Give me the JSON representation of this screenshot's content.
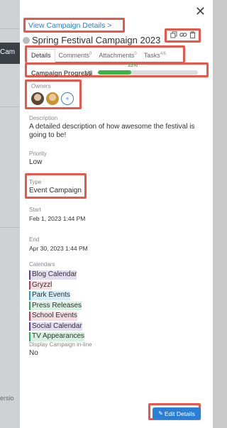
{
  "backdrop": {
    "partial_label": "Cam",
    "partial_version": "ersio"
  },
  "panel": {
    "close_glyph": "✕",
    "view_link": "View Campaign Details >",
    "title": "Spring Festival Campaign 2023",
    "tabs": [
      {
        "label": "Details",
        "count": ""
      },
      {
        "label": "Comments",
        "count": "0"
      },
      {
        "label": "Attachments",
        "count": "0"
      },
      {
        "label": "Tasks",
        "count": "4/6"
      }
    ],
    "progress": {
      "label": "Campaign Progress",
      "count": "1/3",
      "percent_text": "33%",
      "fraction": 0.33,
      "color": "#39b54a"
    },
    "owners": {
      "label": "Owners",
      "add_glyph": "+"
    },
    "description": {
      "label": "Description",
      "value": "A detailed description of how awesome the festival is going to be!"
    },
    "priority": {
      "label": "Priority",
      "value": "Low"
    },
    "type": {
      "label": "Type",
      "value": "Event Campaign"
    },
    "start": {
      "label": "Start",
      "value": "Feb 1, 2023 1:44 PM"
    },
    "end": {
      "label": "End",
      "value": "Apr 30, 2023 1:44 PM"
    },
    "calendars": {
      "label": "Calendars",
      "items": [
        {
          "name": "Blog Calendar",
          "bg": "#e4dcf3",
          "bar": "#5b3d9c"
        },
        {
          "name": "Gryzzl",
          "bg": "#f6dde2",
          "bar": "#c0395a"
        },
        {
          "name": "Park Events",
          "bg": "#d6eef7",
          "bar": "#2a9dc9"
        },
        {
          "name": "Press Releases",
          "bg": "#d9f1e3",
          "bar": "#2fa35f"
        },
        {
          "name": "School Events",
          "bg": "#f6dde2",
          "bar": "#c0395a"
        },
        {
          "name": "Social Calendar",
          "bg": "#e4dcf3",
          "bar": "#5b3d9c"
        },
        {
          "name": "TV Appearances",
          "bg": "#d9f1e3",
          "bar": "#2fa35f"
        }
      ]
    },
    "display_inline": {
      "label": "Display Campaign in-line",
      "value": "No"
    },
    "edit_button": "Edit Details",
    "highlight_color": "#e8574a"
  }
}
